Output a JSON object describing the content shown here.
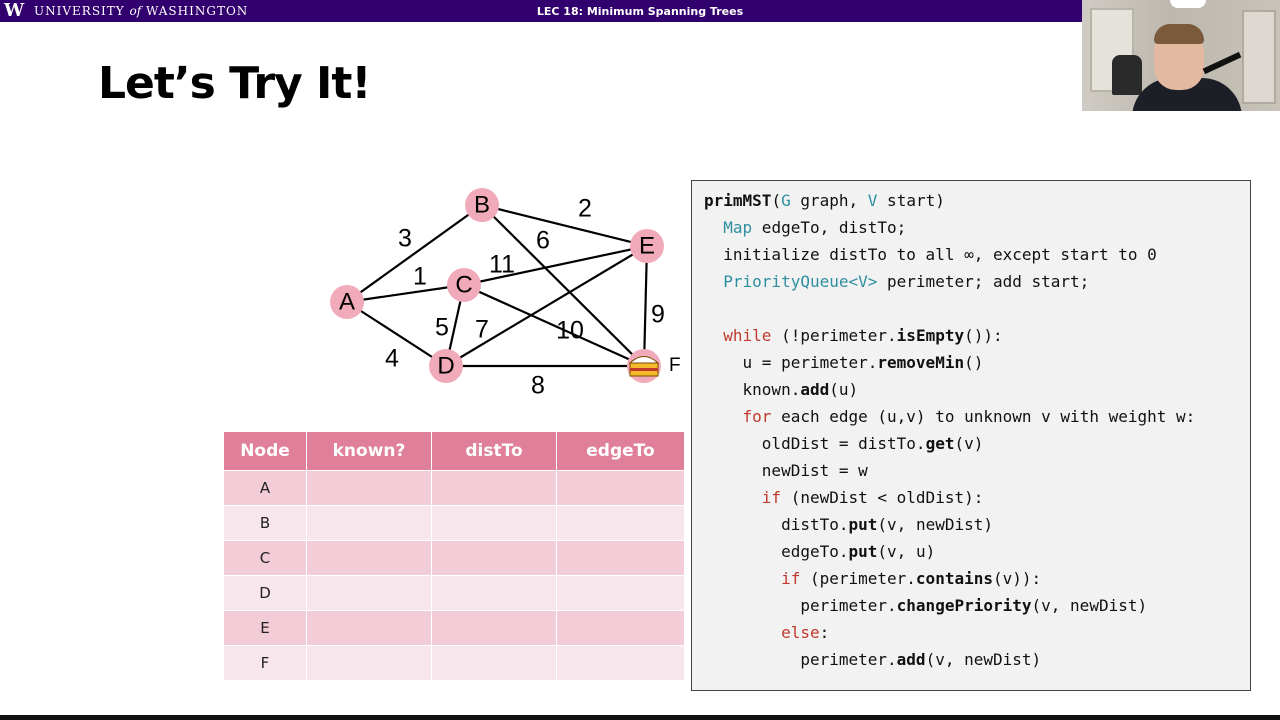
{
  "header": {
    "logo": "W",
    "university_pre": "UNIVERSITY",
    "university_of": "of",
    "university_post": "WASHINGTON",
    "lecture_title": "LEC 18: Minimum Spanning Trees"
  },
  "slide": {
    "title": "Let’s Try It!"
  },
  "colors": {
    "header_bg": "#32006e",
    "node_fill": "#f1aab9",
    "table_header": "#e07f9a",
    "keyword": "#c0392b",
    "type": "#2e8fa0"
  },
  "graph": {
    "nodes": [
      "A",
      "B",
      "C",
      "D",
      "E",
      "F"
    ],
    "edges": [
      {
        "from": "A",
        "to": "B",
        "weight": "3"
      },
      {
        "from": "A",
        "to": "C",
        "weight": "1"
      },
      {
        "from": "A",
        "to": "D",
        "weight": "4"
      },
      {
        "from": "B",
        "to": "E",
        "weight": "2"
      },
      {
        "from": "B",
        "to": "F",
        "weight": "6"
      },
      {
        "from": "C",
        "to": "E",
        "weight": "11"
      },
      {
        "from": "C",
        "to": "D",
        "weight": "5"
      },
      {
        "from": "C",
        "to": "F",
        "weight": "10"
      },
      {
        "from": "D",
        "to": "E",
        "weight": "7"
      },
      {
        "from": "D",
        "to": "F",
        "weight": "8"
      },
      {
        "from": "E",
        "to": "F",
        "weight": "9"
      }
    ],
    "start_marker_icon": "cake-icon"
  },
  "table": {
    "headers": [
      "Node",
      "known?",
      "distTo",
      "edgeTo"
    ],
    "rows": [
      {
        "node": "A",
        "known": "",
        "distTo": "",
        "edgeTo": ""
      },
      {
        "node": "B",
        "known": "",
        "distTo": "",
        "edgeTo": ""
      },
      {
        "node": "C",
        "known": "",
        "distTo": "",
        "edgeTo": ""
      },
      {
        "node": "D",
        "known": "",
        "distTo": "",
        "edgeTo": ""
      },
      {
        "node": "E",
        "known": "",
        "distTo": "",
        "edgeTo": ""
      },
      {
        "node": "F",
        "known": "",
        "distTo": "",
        "edgeTo": ""
      }
    ]
  },
  "code": {
    "lines": [
      [
        {
          "t": "primMST",
          "c": "fn"
        },
        {
          "t": "("
        },
        {
          "t": "G",
          "c": "ty"
        },
        {
          "t": " graph, "
        },
        {
          "t": "V",
          "c": "ty"
        },
        {
          "t": " start)"
        }
      ],
      [
        {
          "t": "  "
        },
        {
          "t": "Map",
          "c": "ty"
        },
        {
          "t": " edgeTo, distTo;"
        }
      ],
      [
        {
          "t": "  initialize distTo to all ∞, except start to 0"
        }
      ],
      [
        {
          "t": "  "
        },
        {
          "t": "PriorityQueue<V>",
          "c": "ty"
        },
        {
          "t": " perimeter; add start;"
        }
      ],
      [
        {
          "t": ""
        }
      ],
      [
        {
          "t": "  "
        },
        {
          "t": "while",
          "c": "kw"
        },
        {
          "t": " (!perimeter."
        },
        {
          "t": "isEmpty",
          "c": "fn"
        },
        {
          "t": "()):"
        }
      ],
      [
        {
          "t": "    u = perimeter."
        },
        {
          "t": "removeMin",
          "c": "fn"
        },
        {
          "t": "()"
        }
      ],
      [
        {
          "t": "    known."
        },
        {
          "t": "add",
          "c": "fn"
        },
        {
          "t": "(u)"
        }
      ],
      [
        {
          "t": "    "
        },
        {
          "t": "for",
          "c": "kw"
        },
        {
          "t": " each edge (u,v) to unknown v with weight w:"
        }
      ],
      [
        {
          "t": "      oldDist = distTo."
        },
        {
          "t": "get",
          "c": "fn"
        },
        {
          "t": "(v)"
        }
      ],
      [
        {
          "t": "      newDist = w"
        }
      ],
      [
        {
          "t": "      "
        },
        {
          "t": "if",
          "c": "kw"
        },
        {
          "t": " (newDist < oldDist):"
        }
      ],
      [
        {
          "t": "        distTo."
        },
        {
          "t": "put",
          "c": "fn"
        },
        {
          "t": "(v, newDist)"
        }
      ],
      [
        {
          "t": "        edgeTo."
        },
        {
          "t": "put",
          "c": "fn"
        },
        {
          "t": "(v, u)"
        }
      ],
      [
        {
          "t": "        "
        },
        {
          "t": "if",
          "c": "kw"
        },
        {
          "t": " (perimeter."
        },
        {
          "t": "contains",
          "c": "fn"
        },
        {
          "t": "(v)):"
        }
      ],
      [
        {
          "t": "          perimeter."
        },
        {
          "t": "changePriority",
          "c": "fn"
        },
        {
          "t": "(v, newDist)"
        }
      ],
      [
        {
          "t": "        "
        },
        {
          "t": "else",
          "c": "kw"
        },
        {
          "t": ":"
        }
      ],
      [
        {
          "t": "          perimeter."
        },
        {
          "t": "add",
          "c": "fn"
        },
        {
          "t": "(v, newDist)"
        }
      ]
    ]
  }
}
